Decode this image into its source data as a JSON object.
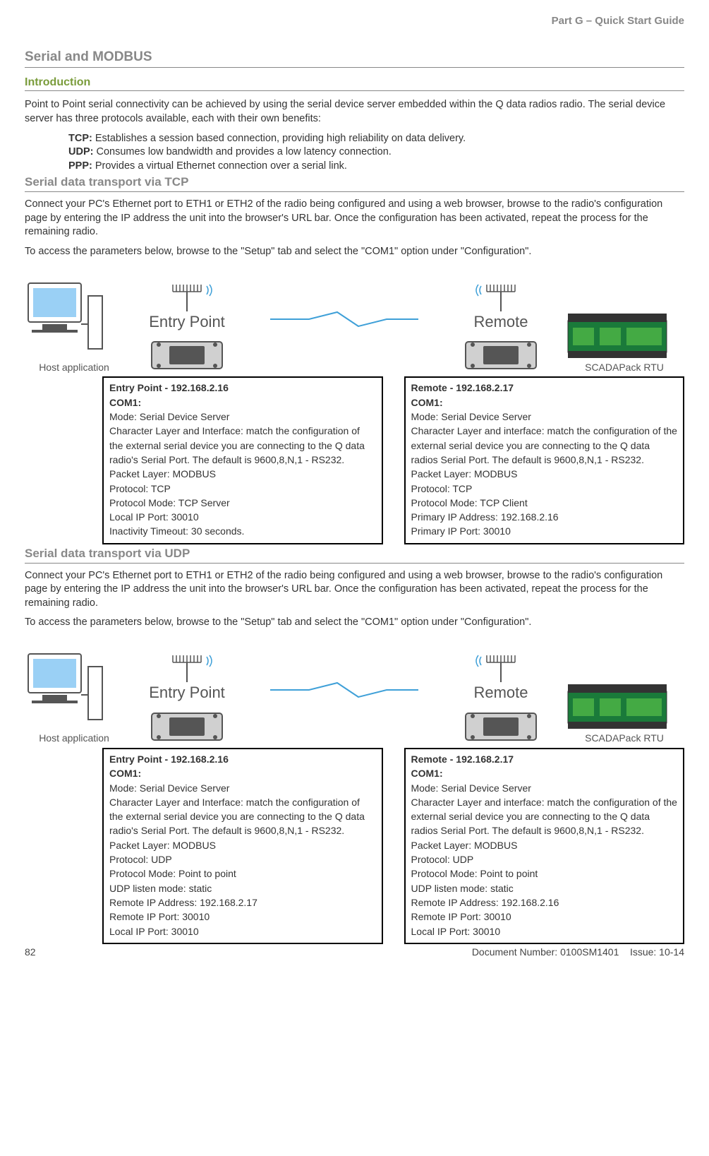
{
  "header": {
    "part": "Part G – Quick Start Guide"
  },
  "section_title": "Serial and MODBUS",
  "intro_heading": "Introduction",
  "intro_para": "Point to Point serial connectivity can be achieved by using the serial device server embedded within the Q data radios radio. The serial device server has three protocols available, each with their own benefits:",
  "protocols": {
    "tcp_label": "TCP:",
    "tcp_text": " Establishes a session based connection, providing high reliability on data delivery.",
    "udp_label": "UDP:",
    "udp_text": " Consumes low bandwidth and provides a low latency connection.",
    "ppp_label": "PPP:",
    "ppp_text": " Provides a virtual Ethernet connection over a serial link."
  },
  "tcp_heading": "Serial data transport via TCP",
  "tcp_para1": "Connect your PC's Ethernet port to ETH1 or ETH2 of the radio being configured and using a web browser, browse to the radio's configuration page by entering the IP address the unit into the browser's URL bar.  Once the configuration has been activated, repeat the process for the remaining radio.",
  "tcp_para2": "To access the parameters below, browse to the \"Setup\" tab and select the \"COM1\" option under \"Configuration\".",
  "diagram": {
    "host_label": "Host application",
    "entry_label": "Entry Point",
    "remote_label": "Remote",
    "rtu_label": "SCADAPack RTU"
  },
  "tcp_entry": {
    "title": "Entry Point - 192.168.2.16",
    "com": "COM1:",
    "l1": "Mode: Serial Device Server",
    "l2": "Character Layer and Interface: match the configuration of the external serial device you are connecting to the Q data radio's Serial Port. The default is 9600,8,N,1 - RS232.",
    "l3": "Packet Layer: MODBUS",
    "l4": "Protocol: TCP",
    "l5": "Protocol Mode: TCP Server",
    "l6": "Local IP Port: 30010",
    "l7": "Inactivity Timeout: 30 seconds."
  },
  "tcp_remote": {
    "title": "Remote - 192.168.2.17",
    "com": "COM1:",
    "l1": "Mode: Serial Device Server",
    "l2": "Character Layer and interface: match the configuration of the external serial device you are connecting to the Q data radios Serial Port. The default is 9600,8,N,1 - RS232.",
    "l3": "Packet Layer: MODBUS",
    "l4": "Protocol: TCP",
    "l5": "Protocol Mode: TCP Client",
    "l6": "Primary IP Address: 192.168.2.16",
    "l7": "Primary IP Port: 30010"
  },
  "udp_heading": "Serial data transport via UDP",
  "udp_para1": "Connect your PC's Ethernet port to ETH1 or ETH2 of the radio being configured and using a web browser, browse to the radio's configuration page by entering the IP address the unit into the browser's URL bar.  Once the configuration has been activated, repeat the process for the remaining radio.",
  "udp_para2": "To access the parameters below, browse to the \"Setup\" tab and select the \"COM1\" option under \"Configuration\".",
  "udp_entry": {
    "title": "Entry Point - 192.168.2.16",
    "com": "COM1:",
    "l1": "Mode: Serial Device Server",
    "l2": "Character Layer and Interface: match the configuration of the external serial device you are connecting to the Q data radio's Serial Port. The default is 9600,8,N,1 - RS232.",
    "l3": "Packet Layer: MODBUS",
    "l4": "Protocol: UDP",
    "l5": "Protocol Mode: Point to point",
    "l6": "UDP listen mode: static",
    "l7": "Remote IP Address: 192.168.2.17",
    "l8": "Remote IP Port: 30010",
    "l9": "Local IP Port: 30010"
  },
  "udp_remote": {
    "title": "Remote - 192.168.2.17",
    "com": "COM1:",
    "l1": "Mode: Serial Device Server",
    "l2": "Character Layer and interface: match the configuration of the external serial device you are connecting to the Q data radios Serial Port. The default is 9600,8,N,1 - RS232.",
    "l3": "Packet Layer: MODBUS",
    "l4": "Protocol: UDP",
    "l5": "Protocol Mode: Point to point",
    "l6": "UDP listen mode: static",
    "l7": "Remote IP Address: 192.168.2.16",
    "l8": "Remote IP Port: 30010",
    "l9": "Local IP Port: 30010"
  },
  "footer": {
    "page": "82",
    "docnum": "Document Number: 0100SM1401",
    "issue": "Issue: 10-14"
  }
}
